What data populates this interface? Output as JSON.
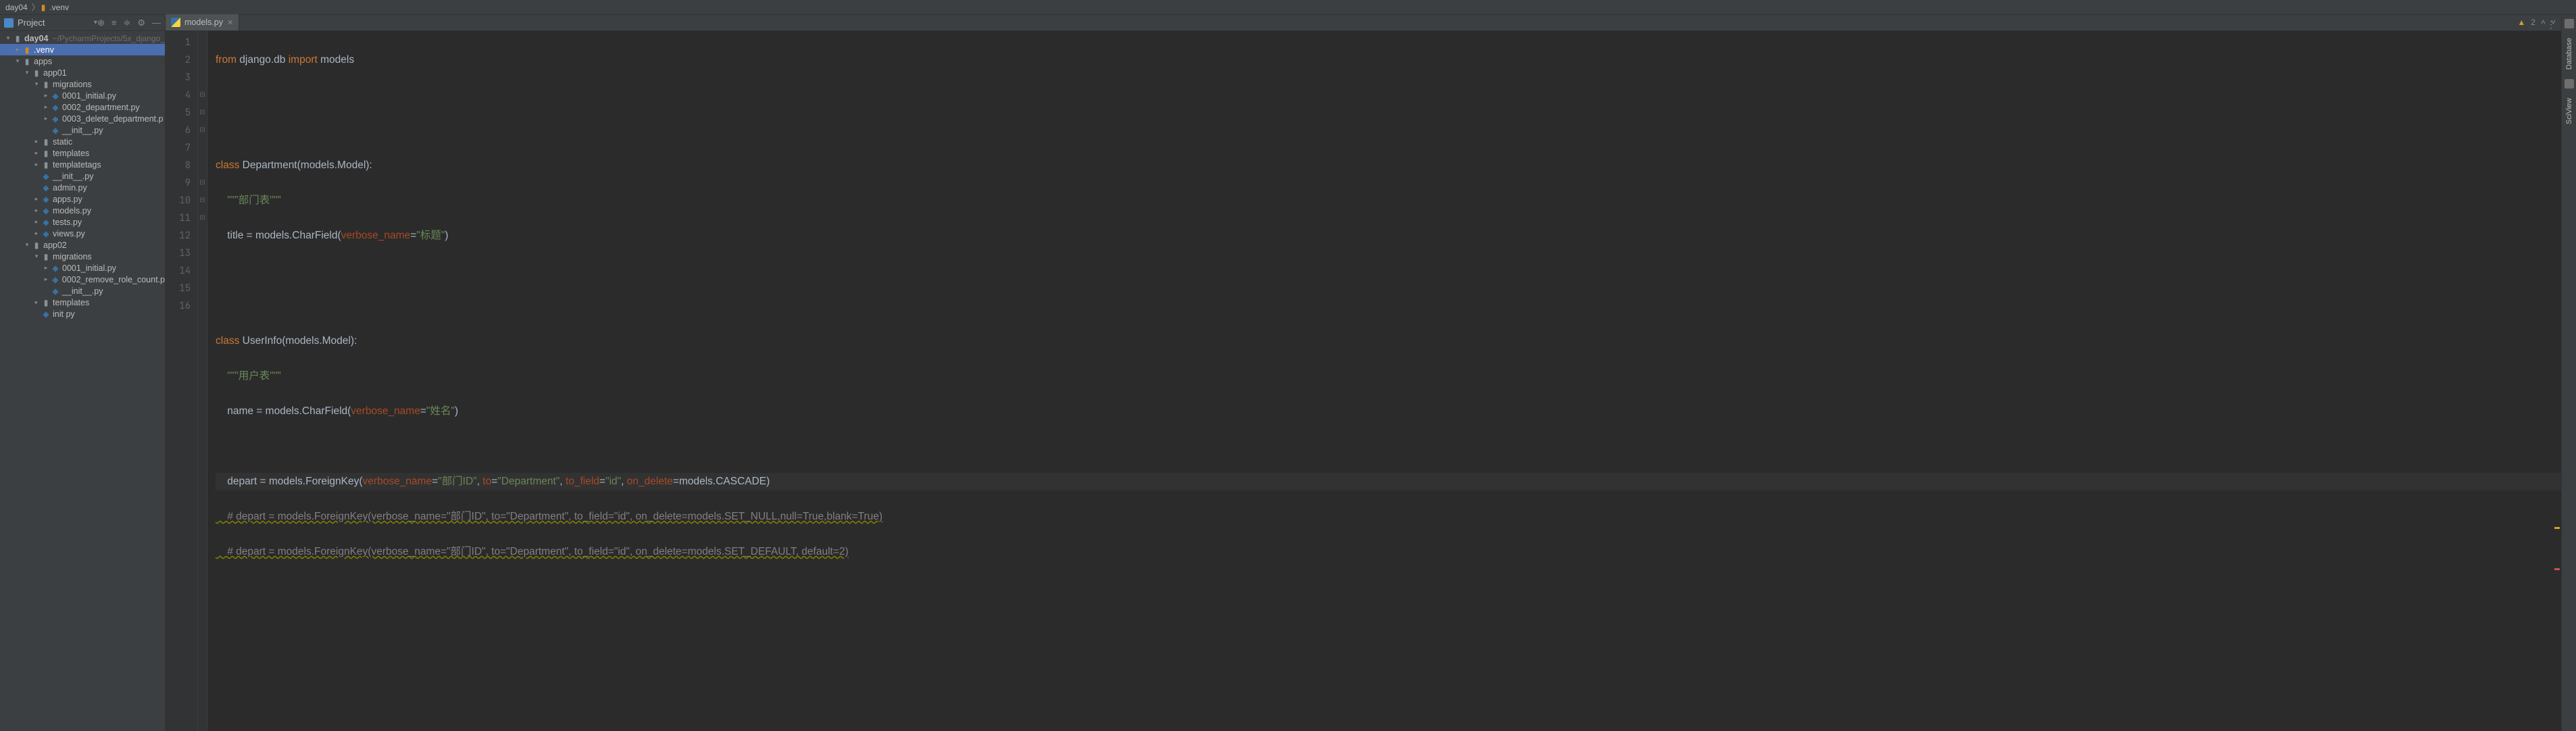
{
  "breadcrumb": {
    "root": "day04",
    "venv": ".venv"
  },
  "sidebar": {
    "title": "Project",
    "root": {
      "name": "day04",
      "path": "~/PycharmProjects/5x_django_"
    },
    "items": [
      {
        "label": ".venv",
        "indent": 1,
        "arrow": "right",
        "icon": "folder-o",
        "selected": true
      },
      {
        "label": "apps",
        "indent": 1,
        "arrow": "down",
        "icon": "folder-b"
      },
      {
        "label": "app01",
        "indent": 2,
        "arrow": "down",
        "icon": "folder-b"
      },
      {
        "label": "migrations",
        "indent": 3,
        "arrow": "down",
        "icon": "folder-b"
      },
      {
        "label": "0001_initial.py",
        "indent": 4,
        "arrow": "right",
        "icon": "py"
      },
      {
        "label": "0002_department.py",
        "indent": 4,
        "arrow": "right",
        "icon": "py"
      },
      {
        "label": "0003_delete_department.p",
        "indent": 4,
        "arrow": "right",
        "icon": "py"
      },
      {
        "label": "__init__.py",
        "indent": 4,
        "arrow": "none",
        "icon": "py"
      },
      {
        "label": "static",
        "indent": 3,
        "arrow": "right",
        "icon": "folder-b"
      },
      {
        "label": "templates",
        "indent": 3,
        "arrow": "right",
        "icon": "folder-b"
      },
      {
        "label": "templatetags",
        "indent": 3,
        "arrow": "right",
        "icon": "folder-b"
      },
      {
        "label": "__init__.py",
        "indent": 3,
        "arrow": "none",
        "icon": "py"
      },
      {
        "label": "admin.py",
        "indent": 3,
        "arrow": "none",
        "icon": "py"
      },
      {
        "label": "apps.py",
        "indent": 3,
        "arrow": "right",
        "icon": "py"
      },
      {
        "label": "models.py",
        "indent": 3,
        "arrow": "right",
        "icon": "py"
      },
      {
        "label": "tests.py",
        "indent": 3,
        "arrow": "right",
        "icon": "py"
      },
      {
        "label": "views.py",
        "indent": 3,
        "arrow": "right",
        "icon": "py"
      },
      {
        "label": "app02",
        "indent": 2,
        "arrow": "down",
        "icon": "folder-b"
      },
      {
        "label": "migrations",
        "indent": 3,
        "arrow": "down",
        "icon": "folder-b"
      },
      {
        "label": "0001_initial.py",
        "indent": 4,
        "arrow": "right",
        "icon": "py"
      },
      {
        "label": "0002_remove_role_count.p",
        "indent": 4,
        "arrow": "right",
        "icon": "py"
      },
      {
        "label": "__init__.py",
        "indent": 4,
        "arrow": "none",
        "icon": "py"
      },
      {
        "label": "templates",
        "indent": 3,
        "arrow": "right",
        "icon": "folder-b"
      },
      {
        "label": "init   py",
        "indent": 3,
        "arrow": "none",
        "icon": "py"
      }
    ]
  },
  "tab": {
    "name": "models.py"
  },
  "editor": {
    "warnings": "2",
    "lines": {
      "l1_from": "from",
      "l1_mod": " django.db ",
      "l1_import": "import",
      "l1_models": " models",
      "l4_class": "class",
      "l4_rest": " Department(models.Model):",
      "l5_doc": "    \"\"\"部门表\"\"\"",
      "l6_a": "    title = models.CharField(",
      "l6_p": "verbose_name",
      "l6_b": "=",
      "l6_s": "\"标题\"",
      "l6_c": ")",
      "l9_class": "class",
      "l9_rest": " UserInfo(models.Model):",
      "l10_doc": "    \"\"\"用户表\"\"\"",
      "l11_a": "    name = models.CharField(",
      "l11_p": "verbose_name",
      "l11_b": "=",
      "l11_s": "\"姓名\"",
      "l11_c": ")",
      "l13_a": "    depart = models.ForeignKey(",
      "l13_p1": "verbose_name",
      "l13_e1": "=",
      "l13_s1": "\"部门ID\"",
      "l13_c1": ", ",
      "l13_p2": "to",
      "l13_e2": "=",
      "l13_s2": "\"Department\"",
      "l13_c2": ", ",
      "l13_p3": "to_field",
      "l13_e3": "=",
      "l13_s3": "\"id\"",
      "l13_c3": ", ",
      "l13_p4": "on_delete",
      "l13_e4": "=models.CASCADE)",
      "l14": "    # depart = models.ForeignKey(verbose_name=\"部门ID\", to=\"Department\", to_field=\"id\", on_delete=models.SET_NULL,null=True,blank=True)",
      "l15": "    # depart = models.ForeignKey(verbose_name=\"部门ID\", to=\"Department\", to_field=\"id\", on_delete=models.SET_DEFAULT, default=2)"
    },
    "linenums": [
      "1",
      "2",
      "3",
      "4",
      "5",
      "6",
      "7",
      "8",
      "9",
      "10",
      "11",
      "12",
      "13",
      "14",
      "15",
      "16"
    ]
  },
  "rightrail": {
    "db": "Database",
    "sci": "SciView"
  }
}
